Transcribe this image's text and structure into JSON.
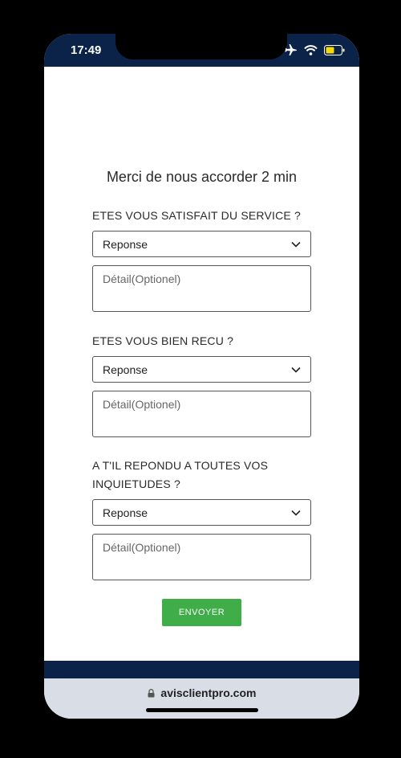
{
  "status_bar": {
    "time": "17:49",
    "icons": [
      "airplane-icon",
      "wifi-icon",
      "battery-icon"
    ]
  },
  "form": {
    "title": "Merci de nous accorder 2 min",
    "questions": [
      {
        "label": "ETES VOUS SATISFAIT DU SERVICE ?",
        "select_value": "Reponse",
        "detail_placeholder": "Détail(Optionel)"
      },
      {
        "label": "ETES VOUS BIEN RECU ?",
        "select_value": "Reponse",
        "detail_placeholder": "Détail(Optionel)"
      },
      {
        "label_line1": "A T'IL REPONDU A TOUTES VOS",
        "label_line2": "INQUIETUDES ?",
        "select_value": "Reponse",
        "detail_placeholder": "Détail(Optionel)"
      }
    ],
    "submit_label": "ENVOYER"
  },
  "browser": {
    "url": "avisclientpro.com"
  },
  "colors": {
    "header": "#0b2349",
    "button": "#3fae49",
    "battery": "#f5d90a"
  }
}
